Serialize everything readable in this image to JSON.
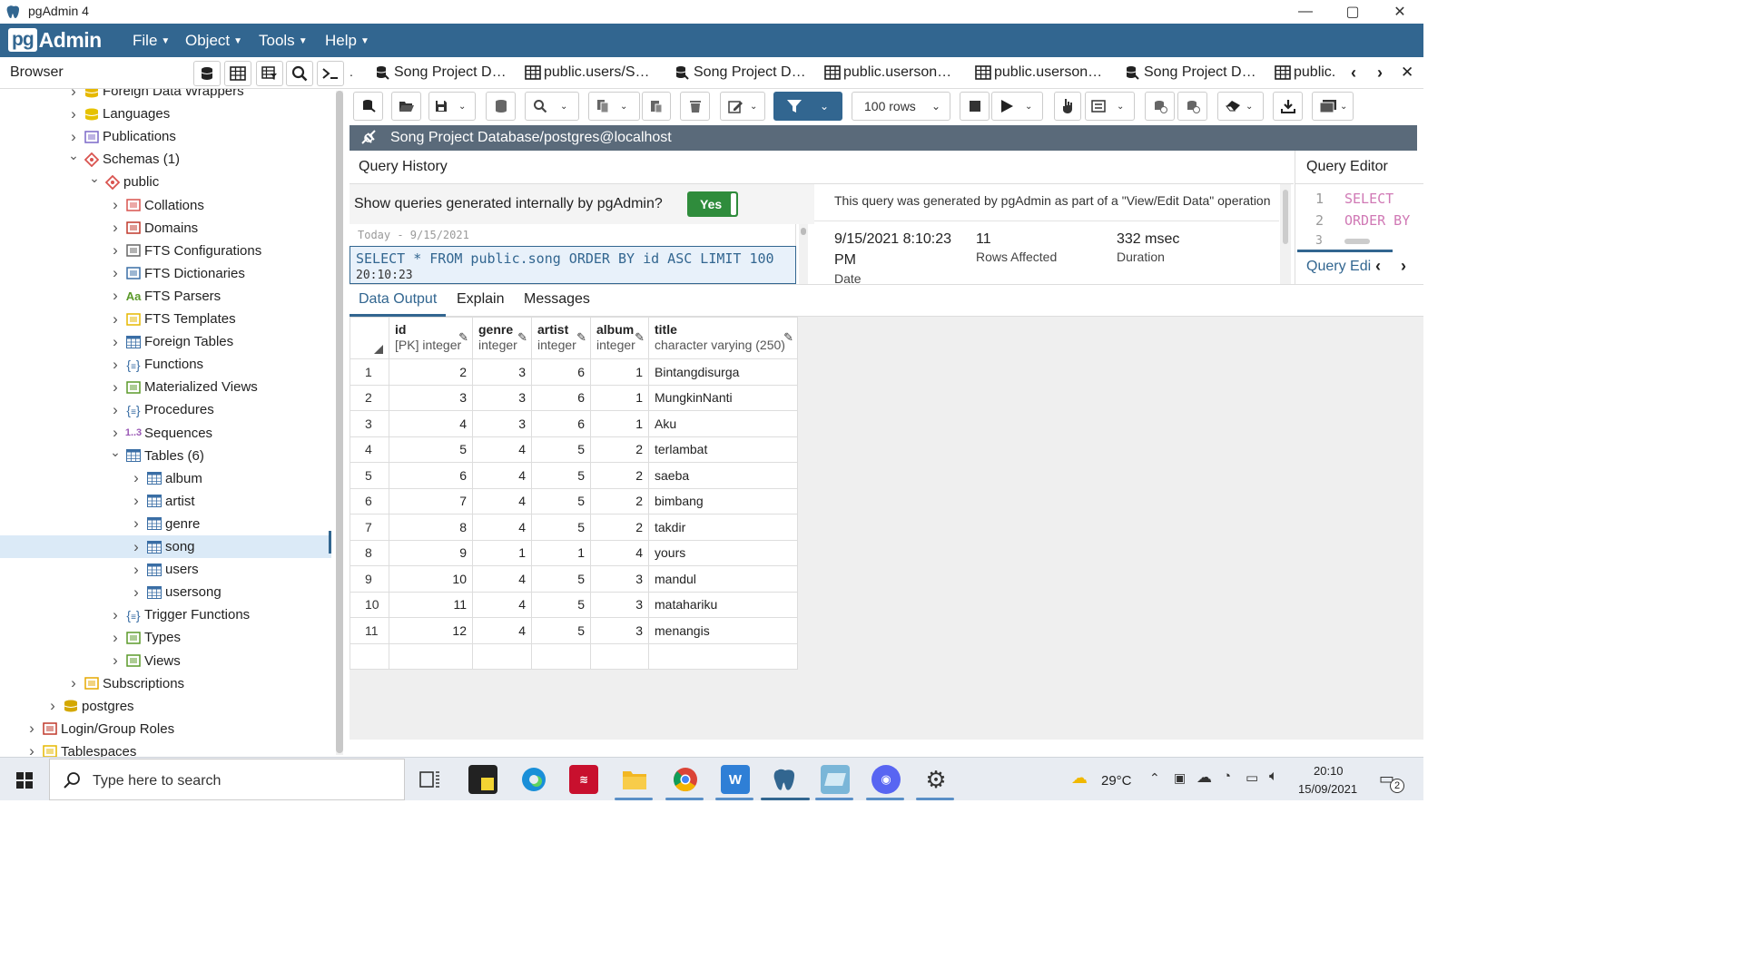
{
  "window": {
    "title": "pgAdmin 4",
    "minimize": "—",
    "maximize": "▢",
    "close": "✕"
  },
  "menubar": {
    "logo_pg": "pg",
    "logo_admin": "Admin",
    "items": [
      {
        "label": "File"
      },
      {
        "label": "Object"
      },
      {
        "label": "Tools"
      },
      {
        "label": "Help"
      }
    ]
  },
  "browser": {
    "title": "Browser",
    "tree": [
      {
        "label": "Foreign Data Wrappers",
        "indent": 1,
        "expanded": false,
        "icon": "fdw-icon",
        "partial": true
      },
      {
        "label": "Languages",
        "indent": 1,
        "expanded": false,
        "icon": "languages-icon"
      },
      {
        "label": "Publications",
        "indent": 1,
        "expanded": false,
        "icon": "publications-icon"
      },
      {
        "label": "Schemas (1)",
        "indent": 1,
        "expanded": true,
        "icon": "schemas-icon"
      },
      {
        "label": "public",
        "indent": 2,
        "expanded": true,
        "icon": "schema-icon"
      },
      {
        "label": "Collations",
        "indent": 3,
        "expanded": false,
        "icon": "collations-icon"
      },
      {
        "label": "Domains",
        "indent": 3,
        "expanded": false,
        "icon": "domains-icon"
      },
      {
        "label": "FTS Configurations",
        "indent": 3,
        "expanded": false,
        "icon": "fts-config-icon"
      },
      {
        "label": "FTS Dictionaries",
        "indent": 3,
        "expanded": false,
        "icon": "fts-dict-icon"
      },
      {
        "label": "FTS Parsers",
        "indent": 3,
        "expanded": false,
        "icon": "fts-parser-icon"
      },
      {
        "label": "FTS Templates",
        "indent": 3,
        "expanded": false,
        "icon": "fts-template-icon"
      },
      {
        "label": "Foreign Tables",
        "indent": 3,
        "expanded": false,
        "icon": "foreign-table-icon"
      },
      {
        "label": "Functions",
        "indent": 3,
        "expanded": false,
        "icon": "function-icon"
      },
      {
        "label": "Materialized Views",
        "indent": 3,
        "expanded": false,
        "icon": "mview-icon"
      },
      {
        "label": "Procedures",
        "indent": 3,
        "expanded": false,
        "icon": "procedure-icon"
      },
      {
        "label": "Sequences",
        "indent": 3,
        "expanded": false,
        "icon": "sequence-icon"
      },
      {
        "label": "Tables (6)",
        "indent": 3,
        "expanded": true,
        "icon": "tables-icon"
      },
      {
        "label": "album",
        "indent": 4,
        "expanded": false,
        "icon": "table-icon"
      },
      {
        "label": "artist",
        "indent": 4,
        "expanded": false,
        "icon": "table-icon"
      },
      {
        "label": "genre",
        "indent": 4,
        "expanded": false,
        "icon": "table-icon"
      },
      {
        "label": "song",
        "indent": 4,
        "expanded": false,
        "icon": "table-icon",
        "selected": true
      },
      {
        "label": "users",
        "indent": 4,
        "expanded": false,
        "icon": "table-icon"
      },
      {
        "label": "usersong",
        "indent": 4,
        "expanded": false,
        "icon": "table-icon"
      },
      {
        "label": "Trigger Functions",
        "indent": 3,
        "expanded": false,
        "icon": "trigger-function-icon"
      },
      {
        "label": "Types",
        "indent": 3,
        "expanded": false,
        "icon": "types-icon"
      },
      {
        "label": "Views",
        "indent": 3,
        "expanded": false,
        "icon": "views-icon"
      },
      {
        "label": "Subscriptions",
        "indent": 1,
        "expanded": false,
        "icon": "subscriptions-icon"
      },
      {
        "label": "postgres",
        "indent": 0,
        "expanded": false,
        "icon": "database-icon"
      },
      {
        "label": "Login/Group Roles",
        "indent": -1,
        "expanded": false,
        "icon": "roles-icon"
      },
      {
        "label": "Tablespaces",
        "indent": -1,
        "expanded": false,
        "icon": "tablespaces-icon"
      }
    ]
  },
  "tabs": [
    {
      "label": "Song Project D…",
      "icon": "query-tool-icon"
    },
    {
      "label": "public.users/S…",
      "icon": "table-view-icon"
    },
    {
      "label": "Song Project D…",
      "icon": "query-tool-icon"
    },
    {
      "label": "public.userson…",
      "icon": "table-view-icon"
    },
    {
      "label": "public.userson…",
      "icon": "table-view-icon"
    },
    {
      "label": "Song Project D…",
      "icon": "query-tool-icon"
    },
    {
      "label": "public.",
      "icon": "table-view-icon"
    }
  ],
  "toolbar": {
    "rows_limit": "100 rows"
  },
  "connection": {
    "label": "Song Project Database/postgres@localhost"
  },
  "query_history": {
    "title": "Query History",
    "toggle_label": "Show queries generated internally by pgAdmin?",
    "toggle_value": "Yes",
    "date_header": "Today - 9/15/2021",
    "entry_query": "SELECT * FROM public.song ORDER BY id ASC LIMIT 100",
    "entry_time": "20:10:23",
    "detail_note": "This query was generated by pgAdmin as part of a \"View/Edit Data\" operation",
    "stats": [
      {
        "value": "9/15/2021 8:10:23 PM",
        "label": "Date"
      },
      {
        "value": "11",
        "label": "Rows Affected"
      },
      {
        "value": "332 msec",
        "label": "Duration"
      }
    ]
  },
  "query_editor": {
    "title": "Query Editor",
    "lines": [
      {
        "n": "1",
        "code": "SELECT"
      },
      {
        "n": "2",
        "code": "ORDER BY"
      },
      {
        "n": "3",
        "code": ""
      }
    ],
    "footer_tab": "Query Edi"
  },
  "output_tabs": [
    {
      "label": "Data Output",
      "active": true
    },
    {
      "label": "Explain",
      "active": false
    },
    {
      "label": "Messages",
      "active": false
    }
  ],
  "grid": {
    "columns": [
      {
        "name": "id",
        "type": "[PK] integer"
      },
      {
        "name": "genre",
        "type": "integer"
      },
      {
        "name": "artist",
        "type": "integer"
      },
      {
        "name": "album",
        "type": "integer"
      },
      {
        "name": "title",
        "type": "character varying (250)"
      }
    ],
    "rows": [
      [
        "1",
        "2",
        "3",
        "6",
        "1",
        "Bintangdisurga"
      ],
      [
        "2",
        "3",
        "3",
        "6",
        "1",
        "MungkinNanti"
      ],
      [
        "3",
        "4",
        "3",
        "6",
        "1",
        "Aku"
      ],
      [
        "4",
        "5",
        "4",
        "5",
        "2",
        "terlambat"
      ],
      [
        "5",
        "6",
        "4",
        "5",
        "2",
        "saeba"
      ],
      [
        "6",
        "7",
        "4",
        "5",
        "2",
        "bimbang"
      ],
      [
        "7",
        "8",
        "4",
        "5",
        "2",
        "takdir"
      ],
      [
        "8",
        "9",
        "1",
        "1",
        "4",
        "yours"
      ],
      [
        "9",
        "10",
        "4",
        "5",
        "3",
        "mandul"
      ],
      [
        "10",
        "11",
        "4",
        "5",
        "3",
        "matahariku"
      ],
      [
        "11",
        "12",
        "4",
        "5",
        "3",
        "menangis"
      ]
    ]
  },
  "taskbar": {
    "search_placeholder": "Type here to search",
    "weather": "29°C",
    "time": "20:10",
    "date": "15/09/2021",
    "notification_count": "2"
  }
}
